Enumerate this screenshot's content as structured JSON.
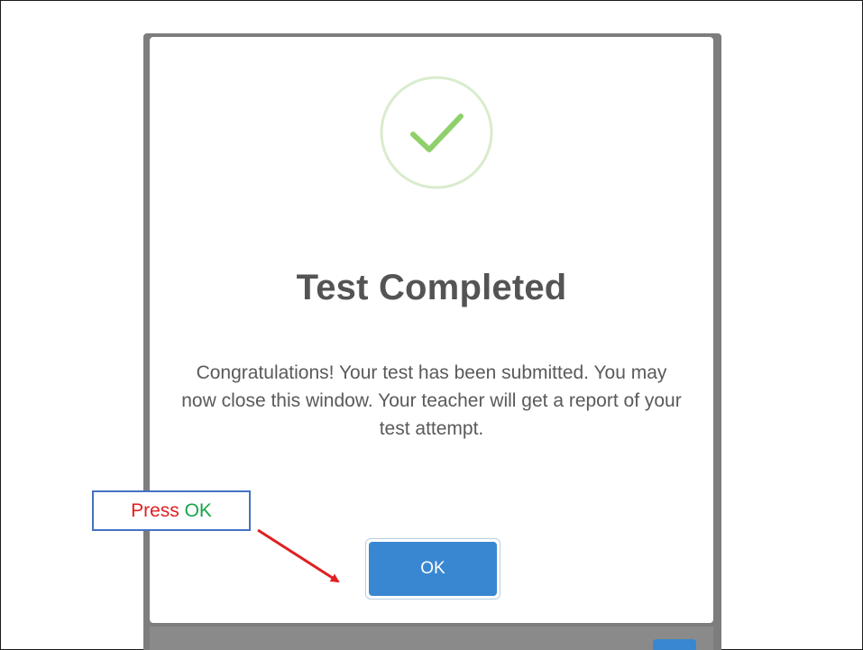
{
  "dialog": {
    "title": "Test Completed",
    "message": "Congratulations! Your test has been submitted. You may now close this window. Your teacher will get a report of your test attempt.",
    "ok_label": "OK",
    "status_icon": "check-circle-icon"
  },
  "annotation": {
    "prefix": "Press",
    "highlight": "OK",
    "prefix_color": "#e02020",
    "highlight_color": "#1aa34a",
    "arrow_color": "#e02020"
  },
  "colors": {
    "primary": "#3a87d1",
    "success": "#8fd06a",
    "success_ring": "#d9eccd",
    "title_text": "#545454"
  }
}
